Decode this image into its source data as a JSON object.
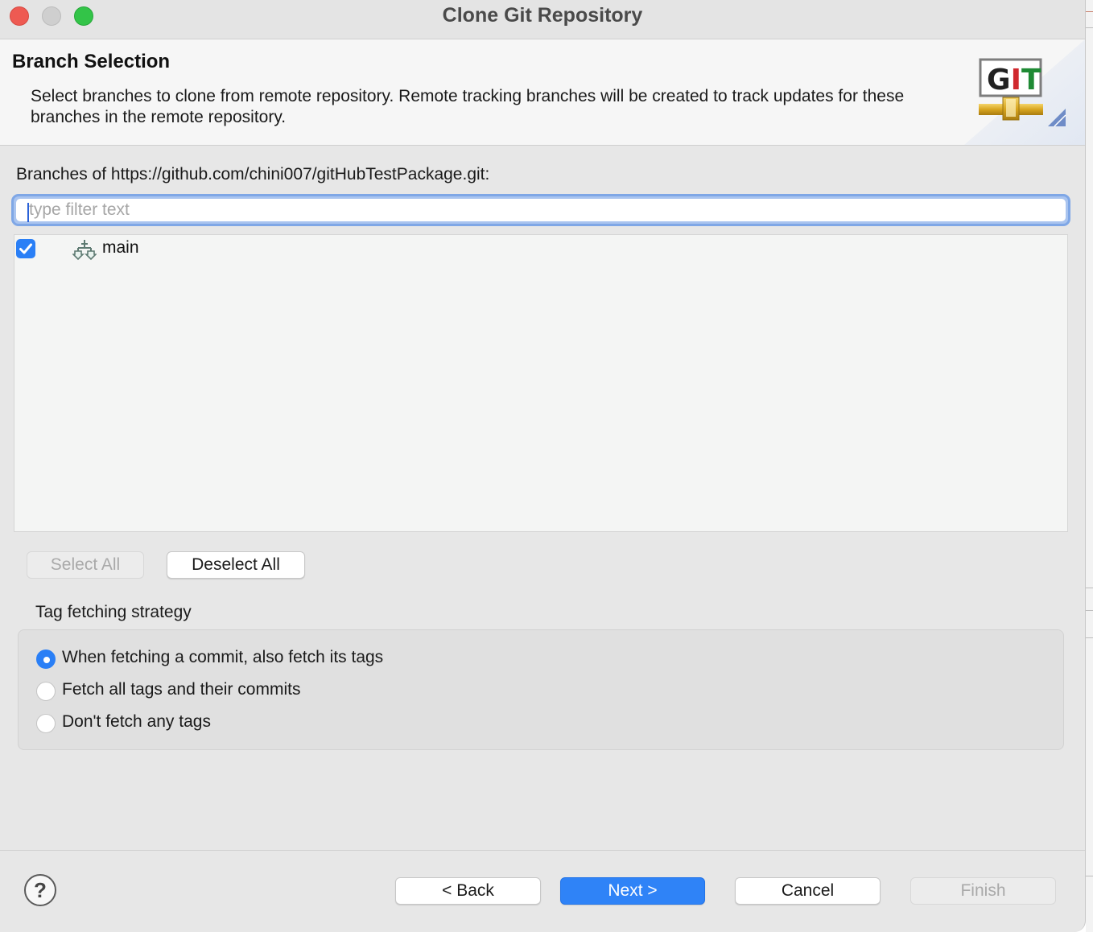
{
  "window": {
    "title": "Clone Git Repository"
  },
  "header": {
    "title": "Branch Selection",
    "description": "Select branches to clone from remote repository. Remote tracking branches will be created to track updates for these branches in the remote repository.",
    "logo_text": "GIT"
  },
  "branches": {
    "label": "Branches of https://github.com/chini007/gitHubTestPackage.git:",
    "filter_placeholder": "type filter text",
    "filter_value": "",
    "items": [
      {
        "name": "main",
        "checked": true,
        "icon": "branch-icon"
      }
    ]
  },
  "selection_buttons": {
    "select_all": "Select All",
    "deselect_all": "Deselect All"
  },
  "tag_strategy": {
    "label": "Tag fetching strategy",
    "options": [
      {
        "label": "When fetching a commit, also fetch its tags",
        "selected": true
      },
      {
        "label": "Fetch all tags and their commits",
        "selected": false
      },
      {
        "label": "Don't fetch any tags",
        "selected": false
      }
    ]
  },
  "footer": {
    "help": "?",
    "back": "< Back",
    "next": "Next >",
    "cancel": "Cancel",
    "finish": "Finish"
  },
  "colors": {
    "accent": "#2f83f7",
    "focus_ring": "#7fa7e6",
    "close": "#ee5a52",
    "zoom": "#33c448"
  }
}
